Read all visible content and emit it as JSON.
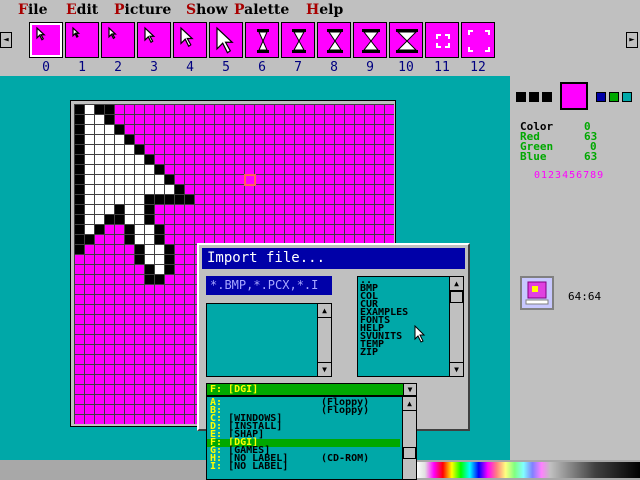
{
  "menu": [
    {
      "accel": "F",
      "rest": "ile"
    },
    {
      "accel": "E",
      "rest": "dit"
    },
    {
      "accel": "P",
      "rest": "icture"
    },
    {
      "accel": "S",
      "rest": "how"
    },
    {
      "accel": "P",
      "rest": "alette"
    },
    {
      "accel": "H",
      "rest": "elp"
    }
  ],
  "toolbar": {
    "left_arrow": "◄",
    "right_arrow": "►",
    "slots": [
      "0",
      "1",
      "2",
      "3",
      "4",
      "5",
      "6",
      "7",
      "8",
      "9",
      "10",
      "11",
      "12"
    ],
    "selected_slot": 0
  },
  "info": {
    "color_label": "Color",
    "color_value": "0",
    "red_label": "Red",
    "red_value": "63",
    "green_label": "Green",
    "green_value": "0",
    "blue_label": "Blue",
    "blue_value": "63",
    "digits": "0123456789",
    "size": "64:64",
    "main_color": "#ff00ff"
  },
  "dialog": {
    "title": "Import file...",
    "filter": "*.BMP,*.PCX,*.I",
    "dirs": [
      "..",
      "BMP",
      "COL",
      "CUR",
      "EXAMPLES",
      "FONTS",
      "HELP",
      "SVUNITS",
      "TEMP",
      "ZIP"
    ],
    "drive_value": "F: [DGI]",
    "drives": [
      {
        "letter": "A:",
        "name": "",
        "extra": "(Floppy)"
      },
      {
        "letter": "B:",
        "name": "",
        "extra": "(Floppy)"
      },
      {
        "letter": "C:",
        "name": "[WINDOWS]",
        "extra": ""
      },
      {
        "letter": "D:",
        "name": "[INSTALL]",
        "extra": ""
      },
      {
        "letter": "E:",
        "name": "[SHAP]",
        "extra": ""
      },
      {
        "letter": "F:",
        "name": "[DGI]",
        "extra": "",
        "selected": true
      },
      {
        "letter": "G:",
        "name": "[GAMES]",
        "extra": ""
      },
      {
        "letter": "H:",
        "name": "[NO LABEL]",
        "extra": "(CD-ROM)"
      },
      {
        "letter": "I:",
        "name": "[NO LABEL]",
        "extra": ""
      }
    ]
  },
  "grid_pattern": [
    "BWBB",
    "BWWB",
    "BWWWB",
    "BWWWWB",
    "BWWWWWB",
    "BWWWWWWB",
    "BWWWWWWWB",
    "BWWWWWWWWB",
    "BWWWWWWWWWB",
    "BWWWWWWBBBBB",
    "BWWWBWWB",
    "BWWBBWWB",
    "BWB..BWWB",
    "BB...BWWB",
    "B.....BWWB",
    "......BWWB",
    ".......BWB",
    ".......BB"
  ]
}
